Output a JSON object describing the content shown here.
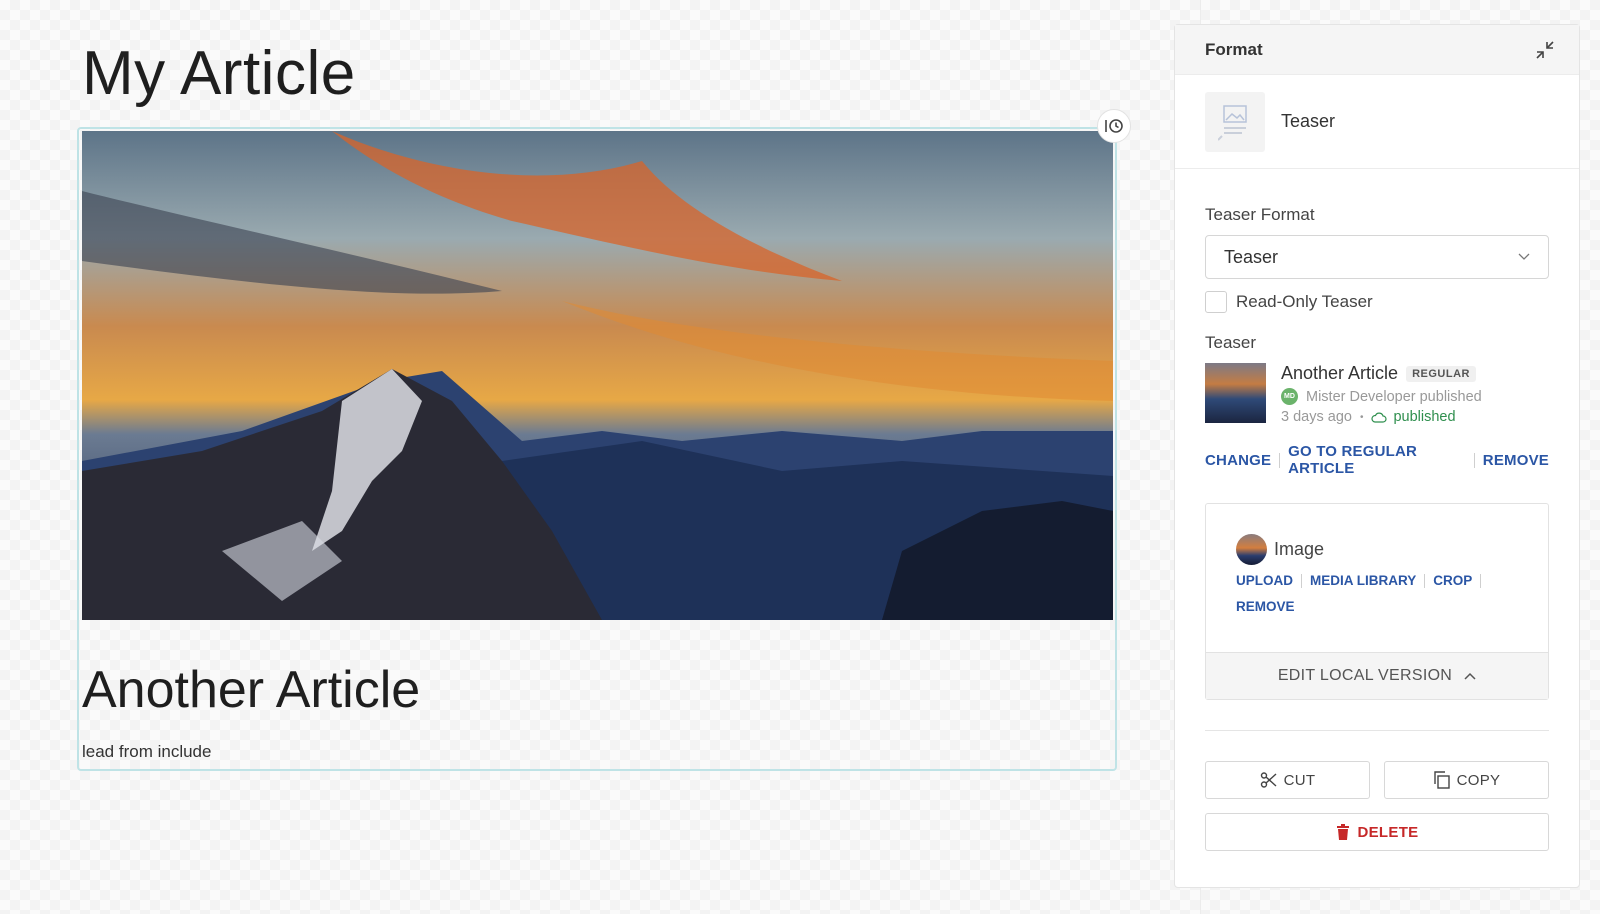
{
  "article": {
    "title": "My Article",
    "teaser_title": "Another Article",
    "teaser_lead": "lead from include"
  },
  "panel": {
    "header": "Format",
    "format_name": "Teaser",
    "teaser_format_label": "Teaser Format",
    "teaser_format_value": "Teaser",
    "readonly_label": "Read-Only Teaser",
    "teaser_label": "Teaser",
    "reference": {
      "title": "Another Article",
      "badge": "REGULAR",
      "avatar_initials": "MD",
      "author_line": "Mister Developer published",
      "time": "3 days ago",
      "status": "published"
    },
    "actions": {
      "change": "CHANGE",
      "go_to": "GO TO REGULAR ARTICLE",
      "remove": "REMOVE"
    },
    "image": {
      "label": "Image",
      "upload": "UPLOAD",
      "media_library": "MEDIA LIBRARY",
      "crop": "CROP",
      "remove": "REMOVE",
      "edit_local": "EDIT LOCAL VERSION"
    },
    "buttons": {
      "cut": "CUT",
      "copy": "COPY",
      "delete": "DELETE"
    }
  },
  "colors": {
    "link": "#2b56a5",
    "published": "#2f8f4e",
    "delete": "#c62828",
    "selection_border": "#bfe3e6"
  }
}
